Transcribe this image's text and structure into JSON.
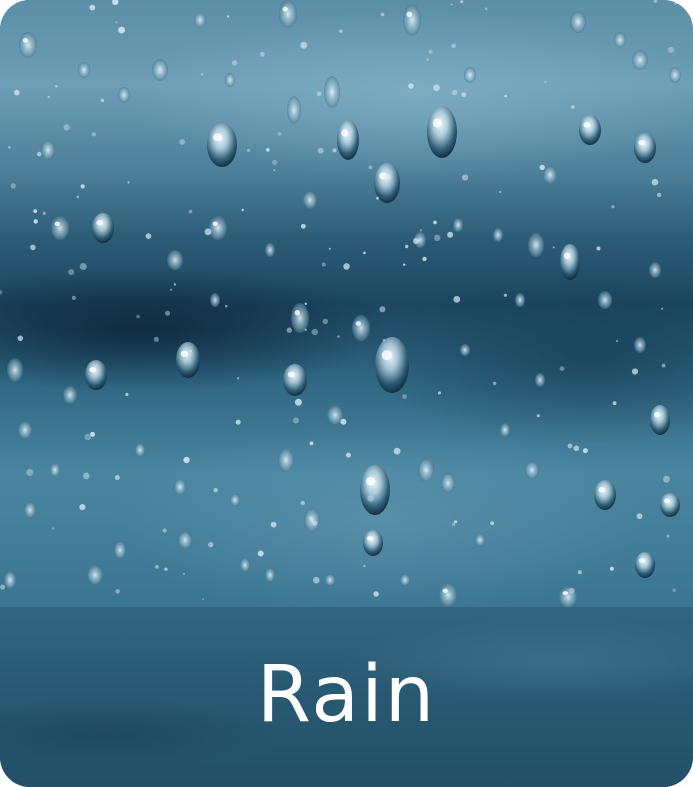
{
  "card": {
    "title": "Rain",
    "image_subject": "raindrops-on-glass"
  },
  "colors": {
    "title_text": "#ffffff",
    "band": "#2a5b74",
    "photo_tone": "#2b5a75"
  }
}
